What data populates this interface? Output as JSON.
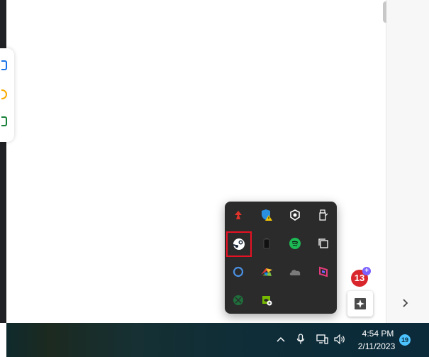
{
  "tray": {
    "icons": [
      {
        "name": "adobe-acrobat-icon",
        "color": "#e0332a"
      },
      {
        "name": "windows-security-warning-icon",
        "color": "#2b8fe0"
      },
      {
        "name": "unknown-shield-icon",
        "color": "#ffffff"
      },
      {
        "name": "usb-drive-icon",
        "color": "#ffffff"
      },
      {
        "name": "steam-icon",
        "color": "#ffffff",
        "selected": true
      },
      {
        "name": "battery-device-icon",
        "color": "#333333"
      },
      {
        "name": "spotify-icon",
        "color": "#1db954"
      },
      {
        "name": "copy-windows-icon",
        "color": "#ffffff"
      },
      {
        "name": "circle-app-icon",
        "color": "#4a90e2"
      },
      {
        "name": "color-wheel-app-icon",
        "color": "#7cc242"
      },
      {
        "name": "onedrive-cloud-icon",
        "color": "#7a7a7a"
      },
      {
        "name": "pink-cube-app-icon",
        "color": "#e63b7a"
      },
      {
        "name": "xbox-icon",
        "color": "#1f6e3b"
      },
      {
        "name": "nvidia-icon",
        "color": "#76b900"
      }
    ]
  },
  "notification_bubble": {
    "count": "13",
    "plus": "+"
  },
  "taskbar": {
    "time": "4:54 PM",
    "date": "2/11/2023",
    "notification_count": "19"
  },
  "colors": {
    "selection_border": "#e81123",
    "tray_background": "#2b2b2b",
    "badge_red": "#d9262c",
    "badge_blue": "#4cc2ff"
  }
}
